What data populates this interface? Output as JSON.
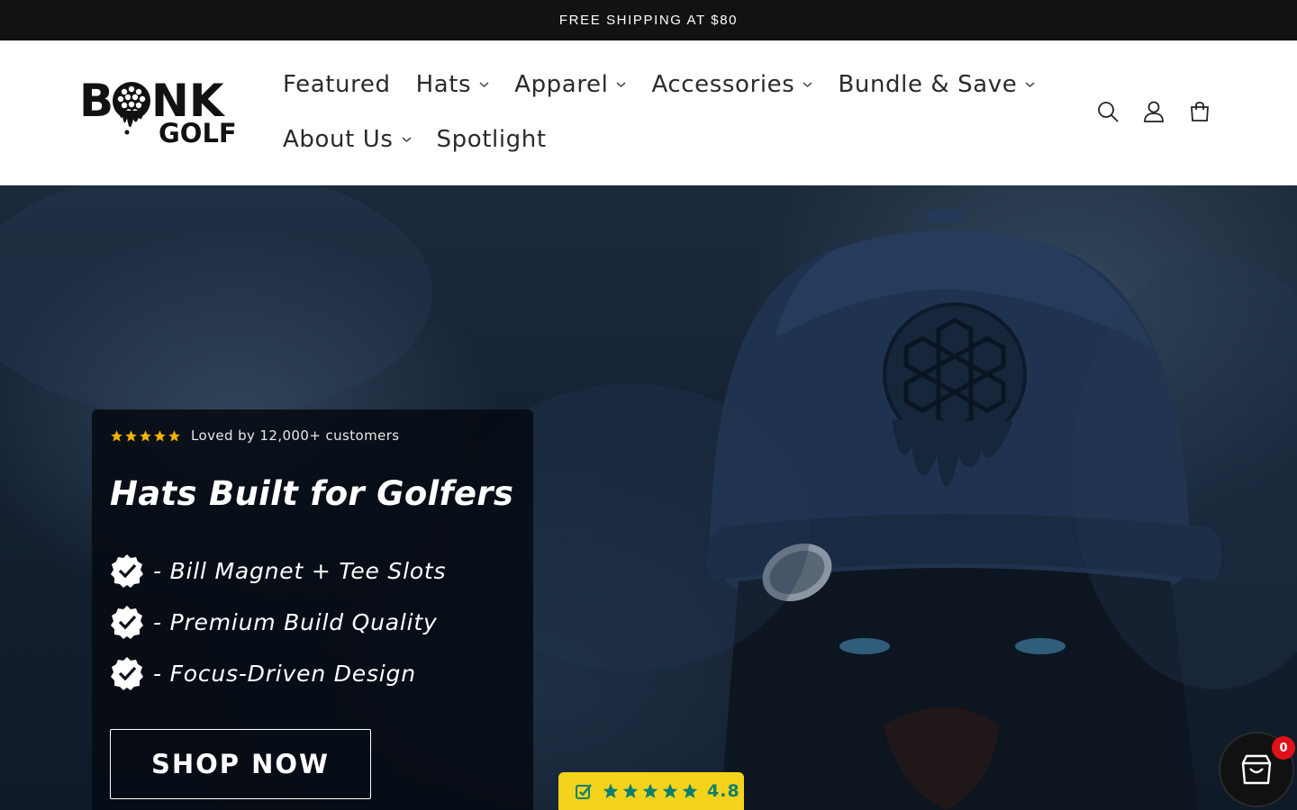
{
  "announcement": {
    "text": "FREE SHIPPING AT $80"
  },
  "brand": {
    "logo_top": "B   NK",
    "logo_bottom": "GOLF"
  },
  "nav": {
    "row1": [
      {
        "label": "Featured",
        "has_dropdown": false
      },
      {
        "label": "Hats",
        "has_dropdown": true
      },
      {
        "label": "Apparel",
        "has_dropdown": true
      },
      {
        "label": "Accessories",
        "has_dropdown": true
      },
      {
        "label": "Bundle & Save",
        "has_dropdown": true
      }
    ],
    "row2": [
      {
        "label": "About Us",
        "has_dropdown": true
      },
      {
        "label": "Spotlight",
        "has_dropdown": false
      }
    ]
  },
  "header_icons": [
    "search-icon",
    "account-icon",
    "cart-icon"
  ],
  "hero": {
    "rating_text": "Loved by 12,000+ customers",
    "star_count": 5,
    "title": "Hats Built for Golfers",
    "features": [
      "- Bill Magnet + Tee Slots",
      "- Premium Build Quality",
      "- Focus-Driven Design"
    ],
    "cta": "SHOP NOW"
  },
  "review_badge": {
    "score": "4.8",
    "stars": 5
  },
  "floating_cart": {
    "count": "0"
  },
  "colors": {
    "announcement_bg": "#121212",
    "hero_bg": "#152233",
    "review_badge_bg": "#f4d31c",
    "review_green": "#10806e",
    "cart_count_bg": "#e0101a"
  }
}
